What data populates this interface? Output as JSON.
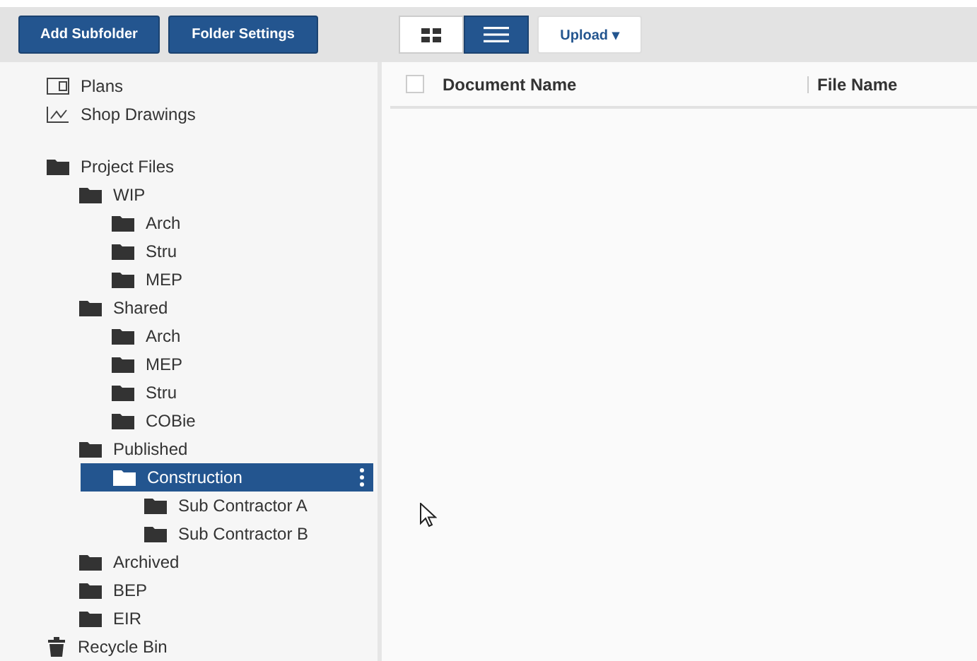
{
  "toolbar": {
    "buttons": [
      "Add Subfolder",
      "Folder Settings"
    ],
    "views": [
      {
        "kind": "grid",
        "selected": false
      },
      {
        "kind": "list",
        "selected": true
      }
    ],
    "upload": {
      "label": "Upload",
      "caret": "▾"
    }
  },
  "sidebar": {
    "top_items": [
      {
        "kind": "plans",
        "label": "Plans"
      },
      {
        "kind": "drawings",
        "label": "Shop Drawings"
      }
    ],
    "tree": [
      {
        "kind": "folder",
        "label": "Project Files",
        "selected": false,
        "children": [
          {
            "kind": "folder",
            "label": "WIP",
            "selected": false,
            "children": [
              {
                "kind": "folder",
                "label": "Arch",
                "selected": false
              },
              {
                "kind": "folder",
                "label": "Stru",
                "selected": false
              },
              {
                "kind": "folder",
                "label": "MEP",
                "selected": false
              }
            ]
          },
          {
            "kind": "folder",
            "label": "Shared",
            "selected": false,
            "children": [
              {
                "kind": "folder",
                "label": "Arch",
                "selected": false
              },
              {
                "kind": "folder",
                "label": "MEP",
                "selected": false
              },
              {
                "kind": "folder",
                "label": "Stru",
                "selected": false
              },
              {
                "kind": "folder",
                "label": "COBie",
                "selected": false
              }
            ]
          },
          {
            "kind": "folder",
            "label": "Published",
            "selected": false,
            "children": [
              {
                "kind": "folder",
                "label": "Construction",
                "selected": true,
                "children": [
                  {
                    "kind": "folder",
                    "label": "Sub Contractor A",
                    "selected": false
                  },
                  {
                    "kind": "folder",
                    "label": "Sub Contractor B",
                    "selected": false
                  }
                ]
              }
            ]
          },
          {
            "kind": "folder",
            "label": "Archived",
            "selected": false
          },
          {
            "kind": "folder",
            "label": "BEP",
            "selected": false
          },
          {
            "kind": "folder",
            "label": "EIR",
            "selected": false
          }
        ]
      },
      {
        "kind": "trash",
        "label": "Recycle Bin",
        "selected": false
      }
    ]
  },
  "table": {
    "select_all": {
      "checked": false
    },
    "columns": [
      "Document Name",
      "File Name"
    ]
  }
}
